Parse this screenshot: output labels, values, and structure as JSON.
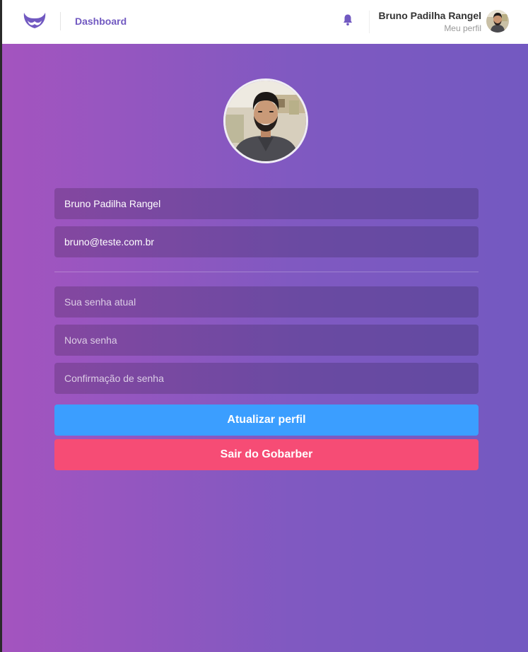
{
  "header": {
    "logo_icon": "mustache-logo-icon",
    "nav_link": "Dashboard",
    "notification_icon": "bell-icon",
    "profile": {
      "name": "Bruno Padilha Rangel",
      "link": "Meu perfil"
    }
  },
  "form": {
    "name_value": "Bruno Padilha Rangel",
    "email_value": "bruno@teste.com.br",
    "old_password_placeholder": "Sua senha atual",
    "new_password_placeholder": "Nova senha",
    "confirm_password_placeholder": "Confirmação de senha",
    "submit_label": "Atualizar perfil"
  },
  "logout_label": "Sair do Gobarber",
  "colors": {
    "brand": "#7159c1",
    "update_button": "#3b9eff",
    "logout_button": "#f64c75",
    "gradient_start": "#a454bf",
    "gradient_end": "#7359c1"
  }
}
